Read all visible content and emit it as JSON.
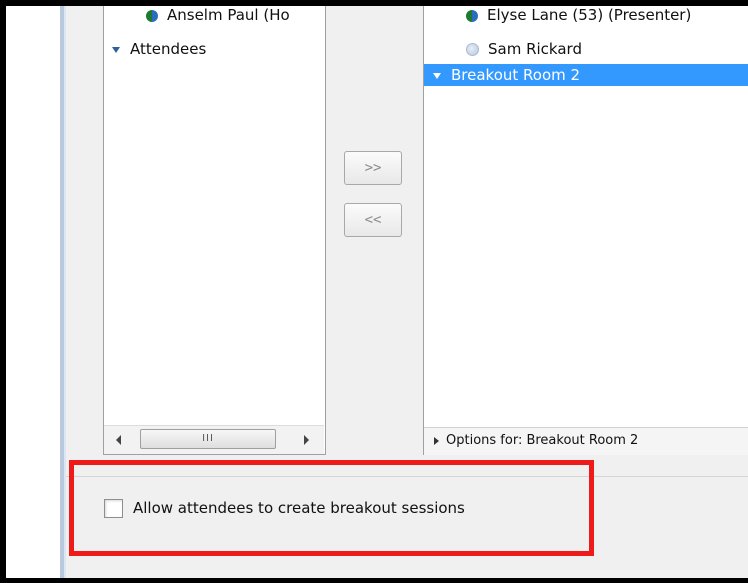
{
  "left_panel": {
    "items": [
      {
        "label": "Anselm Paul (Ho",
        "icon": "presenter-status-icon"
      },
      {
        "label": "Attendees",
        "icon": "collapse-arrow-icon"
      }
    ]
  },
  "right_panel": {
    "items": [
      {
        "label": "Elyse Lane (53) (Presenter)",
        "icon": "presenter-status-icon"
      },
      {
        "label": "Sam Rickard",
        "icon": "idle-status-icon"
      },
      {
        "label": "Breakout Room 2",
        "icon": "collapse-arrow-icon",
        "selected": true
      }
    ],
    "options_label": "Options for: Breakout Room 2"
  },
  "buttons": {
    "move_right": ">>",
    "move_left": "<<"
  },
  "scrollbar": {
    "thumb_grip": "III"
  },
  "settings": {
    "allow_breakout_label": "Allow attendees to create breakout sessions",
    "allow_breakout_checked": false
  },
  "colors": {
    "selection": "#3399ff",
    "highlight": "#ee1b1b"
  }
}
